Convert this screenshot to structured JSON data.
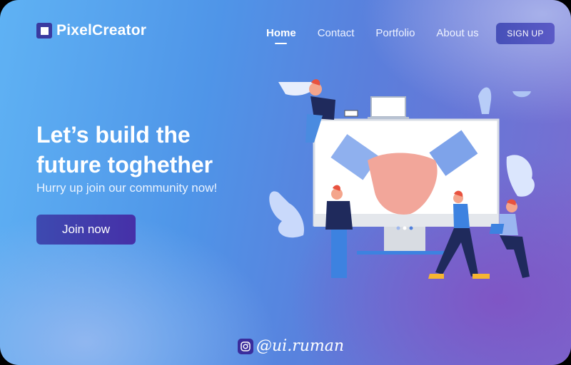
{
  "brand": {
    "name": "PixelCreator",
    "logo_icon": "square-logo-icon"
  },
  "nav": {
    "items": [
      {
        "label": "Home",
        "active": true
      },
      {
        "label": "Contact",
        "active": false
      },
      {
        "label": "Portfolio",
        "active": false
      },
      {
        "label": "About us",
        "active": false
      }
    ],
    "signup_label": "SIGN UP"
  },
  "hero": {
    "title_line1": "Let’s build the",
    "title_line2": "future toghether",
    "subtitle": "Hurry up join our community now!",
    "cta_label": "Join now"
  },
  "illustration": {
    "description": "handshake-on-monitor-with-people",
    "carousel_dots": 3
  },
  "footer": {
    "social_icon": "instagram-icon",
    "handle": "@ui.ruman"
  },
  "colors": {
    "accent": "#4650b8",
    "cta": "#3d4ab0",
    "bg_start": "#5fb2f4",
    "bg_end": "#7a6cd0"
  }
}
